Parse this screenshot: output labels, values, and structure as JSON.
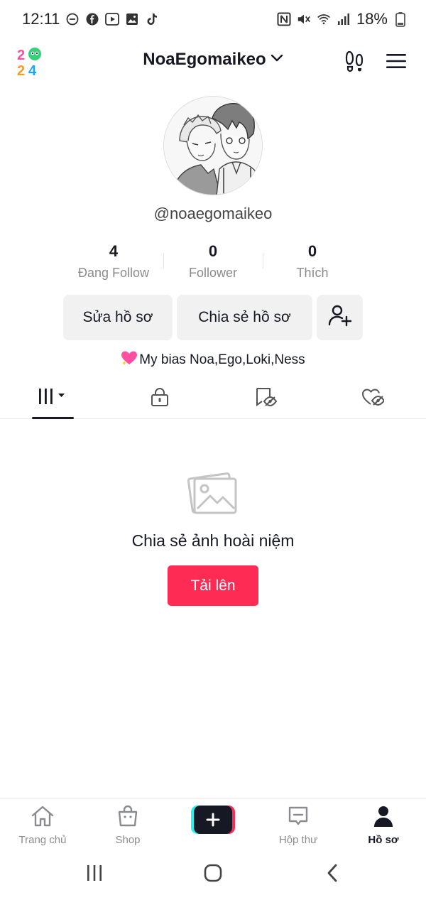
{
  "status_bar": {
    "time": "12:11",
    "battery": "18%"
  },
  "header": {
    "username": "NoaEgomaikeo",
    "logo_digits": [
      "2",
      "0",
      "2",
      "4"
    ]
  },
  "profile": {
    "handle": "@noaegomaikeo",
    "stats": [
      {
        "value": "4",
        "label": "Đang Follow"
      },
      {
        "value": "0",
        "label": "Follower"
      },
      {
        "value": "0",
        "label": "Thích"
      }
    ],
    "edit_label": "Sửa hồ sơ",
    "share_label": "Chia sẻ hồ sơ",
    "bio": "My bias Noa,Ego,Loki,Ness"
  },
  "tabs": [
    {
      "icon": "grid-icon",
      "active": true
    },
    {
      "icon": "lock-icon",
      "active": false
    },
    {
      "icon": "bookmark-icon",
      "active": false
    },
    {
      "icon": "heart-hidden-icon",
      "active": false
    }
  ],
  "empty_state": {
    "title": "Chia sẻ ảnh hoài niệm",
    "button": "Tải lên"
  },
  "bottom_nav": [
    {
      "label": "Trang chủ",
      "icon": "home-icon",
      "active": false
    },
    {
      "label": "Shop",
      "icon": "shop-icon",
      "active": false
    },
    {
      "label": "",
      "icon": "plus-icon",
      "active": false
    },
    {
      "label": "Hộp thư",
      "icon": "inbox-icon",
      "active": false
    },
    {
      "label": "Hồ sơ",
      "icon": "profile-icon",
      "active": true
    }
  ],
  "colors": {
    "accent": "#fe2c55",
    "text": "#161823",
    "muted": "#8a8b91",
    "button_bg": "#f1f1f2"
  }
}
